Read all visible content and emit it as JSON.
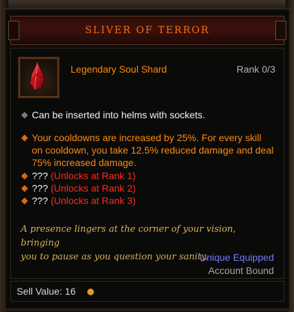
{
  "title": "SLIVER OF TERROR",
  "item": {
    "type": "Legendary Soul Shard",
    "rank": "Rank 0/3",
    "icon": "red-soul-shard-icon"
  },
  "socket_text": "Can be inserted into helms with sockets.",
  "effect": {
    "lines": [
      "Your cooldowns are increased by 25%. For every skill",
      "on cooldown, you take 12.5% reduced damage and deal",
      "75% increased damage."
    ]
  },
  "locked_ranks": [
    {
      "label": "???",
      "unlock": "(Unlocks at Rank 1)"
    },
    {
      "label": "???",
      "unlock": "(Unlocks at Rank 2)"
    },
    {
      "label": "???",
      "unlock": "(Unlocks at Rank 3)"
    }
  ],
  "flavor": {
    "line1": "A presence lingers at the corner of your vision, bringing",
    "line2": "you to pause as you question your sanity."
  },
  "equip_text": "Unique Equipped",
  "bound_text": "Account Bound",
  "sell": {
    "label": "Sell Value:",
    "value": "16",
    "icon": "gold-coin-icon"
  },
  "colors": {
    "title": "#ff6a10",
    "legendary": "#ff8a00",
    "locked": "#ff2a1a",
    "flavor": "#d8b05a",
    "unique": "#6f7bff"
  }
}
